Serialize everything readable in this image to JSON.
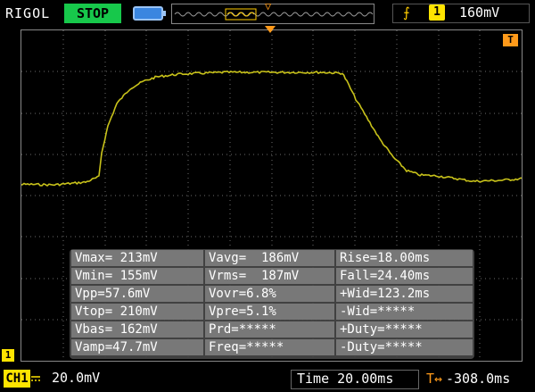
{
  "header": {
    "brand": "RIGOL",
    "run_state": "STOP",
    "trigger_channel": "1",
    "trigger_level": "160mV"
  },
  "markers": {
    "trigger_pos_label": "T",
    "trigger_level_label": "T",
    "channel_marker_label": "1"
  },
  "waveform": {
    "color": "#c8c21a",
    "points": [
      [
        0,
        205
      ],
      [
        60,
        206
      ],
      [
        95,
        203
      ],
      [
        110,
        197
      ],
      [
        113,
        170
      ],
      [
        120,
        140
      ],
      [
        130,
        115
      ],
      [
        145,
        98
      ],
      [
        160,
        90
      ],
      [
        175,
        85
      ],
      [
        200,
        82
      ],
      [
        250,
        80
      ],
      [
        300,
        80
      ],
      [
        360,
        80
      ],
      [
        383,
        81
      ],
      [
        388,
        90
      ],
      [
        398,
        110
      ],
      [
        410,
        130
      ],
      [
        425,
        155
      ],
      [
        440,
        175
      ],
      [
        455,
        190
      ],
      [
        470,
        195
      ],
      [
        490,
        196
      ],
      [
        510,
        199
      ],
      [
        530,
        202
      ],
      [
        560,
        201
      ],
      [
        585,
        199
      ]
    ]
  },
  "measurements": {
    "col1": [
      "Vmax= 213mV",
      "Vmin= 155mV",
      "Vpp=57.6mV",
      "Vtop= 210mV",
      "Vbas= 162mV",
      "Vamp=47.7mV"
    ],
    "col2": [
      "Vavg=  186mV",
      "Vrms=  187mV",
      "Vovr=6.8%",
      "Vpre=5.1%",
      "Prd=*****",
      "Freq=*****"
    ],
    "col3": [
      "Rise=18.00ms",
      "Fall=24.40ms",
      "+Wid=123.2ms",
      "-Wid=*****",
      "+Duty=*****",
      "-Duty=*****"
    ]
  },
  "footer": {
    "channel_label": "CH1",
    "volts_per_div": "20.0mV",
    "timebase": "Time 20.00ms",
    "trigger_offset": "-308.0ms"
  },
  "colors": {
    "channel": "#ffe400",
    "trigger": "#ff9a1a",
    "stop": "#17c84b",
    "grid": "#6d6d6d"
  }
}
